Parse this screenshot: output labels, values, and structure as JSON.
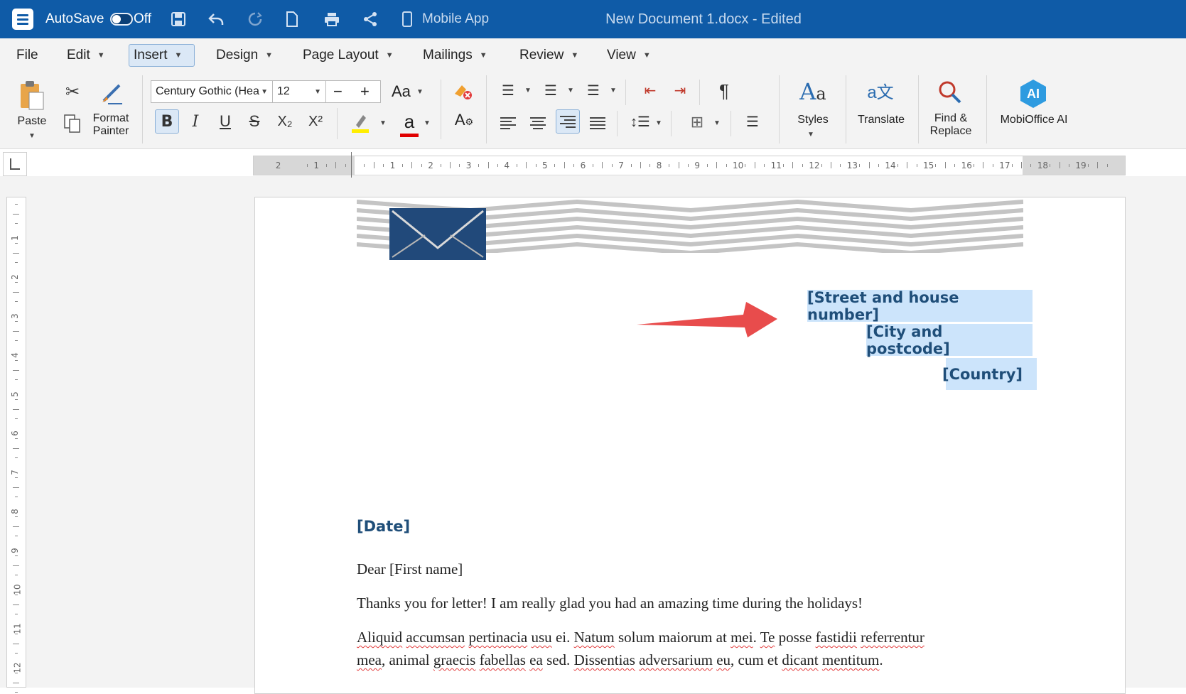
{
  "titlebar": {
    "autosave_label": "AutoSave",
    "autosave_state": "Off",
    "mobile_app": "Mobile App",
    "document_title": "New Document 1.docx - Edited",
    "background_color": "#0f5ba7"
  },
  "menu": {
    "items": [
      "File",
      "Edit",
      "Insert",
      "Design",
      "Page Layout",
      "Mailings",
      "Review",
      "View"
    ],
    "active": "Insert"
  },
  "ribbon": {
    "paste": "Paste",
    "format_painter": [
      "Format",
      "Painter"
    ],
    "font_name": "Century Gothic (Hea",
    "font_size": "12",
    "change_case": "Aa",
    "bold": "B",
    "italic": "I",
    "underline": "U",
    "strikethrough": "S",
    "subscript": "X₂",
    "superscript": "X²",
    "font_color_letter": "a",
    "pilcrow": "¶",
    "styles": "Styles",
    "translate": "Translate",
    "find_replace": [
      "Find &",
      "Replace"
    ],
    "mobioffice_ai": "MobiOffice AI",
    "ai_badge": "AI",
    "highlight_color": "#ffee00",
    "font_color": "#e00000"
  },
  "ruler": {
    "horizontal_labels": [
      "2",
      "1",
      "1",
      "2",
      "3",
      "4",
      "5",
      "6",
      "7",
      "8",
      "9",
      "10",
      "11",
      "12",
      "13",
      "14",
      "15",
      "16",
      "17",
      "18",
      "19"
    ],
    "vertical_labels": [
      "1",
      "2",
      "3",
      "4",
      "5",
      "6",
      "7",
      "8",
      "9",
      "10",
      "11",
      "12"
    ]
  },
  "document": {
    "address_lines": [
      "[Street and house number]",
      "[City and postcode]",
      "[Country]"
    ],
    "date": "[Date]",
    "greeting": "Dear [First name]",
    "line1": "Thanks you for letter! I am really glad you had an amazing time during the holidays!",
    "para_line1": [
      "Aliquid",
      "accumsan",
      "pertinacia",
      "usu",
      "ei. ",
      "Natum",
      "solum maiorum at ",
      "mei",
      ". ",
      "Te",
      " posse ",
      "fastidii",
      " ",
      "referrentur"
    ],
    "para_line2": [
      "mea",
      ", animal ",
      "graecis",
      " ",
      "fabellas",
      " ",
      "ea",
      " sed. ",
      "Dissentias",
      " ",
      "adversarium",
      " ",
      "eu",
      ", cum et ",
      "dicant",
      " ",
      "mentitum",
      "."
    ],
    "accent_color": "#1f4e79",
    "selection_color": "#cce4fb",
    "annotation_arrow_color": "#e84c4c"
  }
}
